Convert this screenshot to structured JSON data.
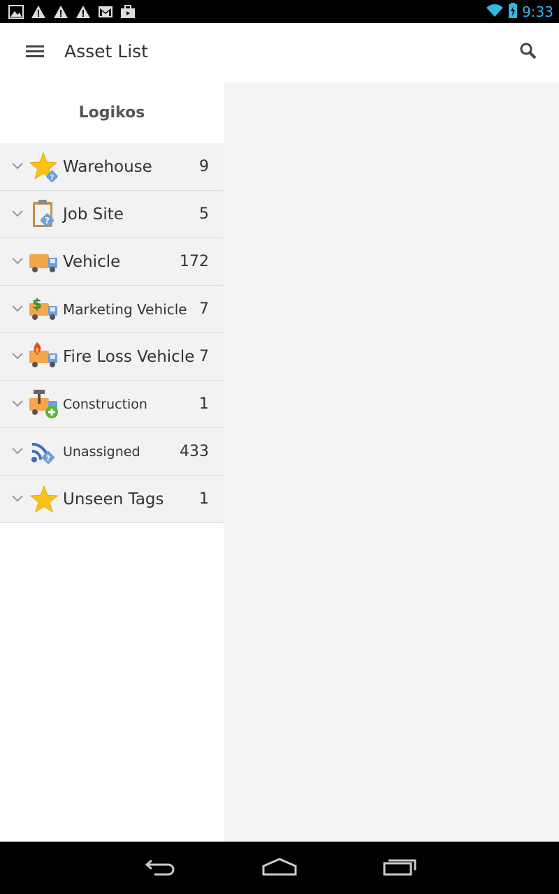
{
  "status_bar": {
    "time": "9:33",
    "left_icons": [
      "image-icon",
      "warning-icon",
      "warning-icon",
      "warning-icon",
      "gmail-icon",
      "briefcase-icon"
    ],
    "right_icons": [
      "wifi-icon",
      "battery-charging-icon"
    ],
    "time_color": "#33b5e5"
  },
  "app_bar": {
    "title": "Asset List",
    "menu_icon": "hamburger-menu-icon",
    "search_icon": "search-icon"
  },
  "sidebar": {
    "organization": "Logikos",
    "items": [
      {
        "label": "Warehouse",
        "count": "9",
        "icon": "star-question-icon"
      },
      {
        "label": "Job Site",
        "count": "5",
        "icon": "clipboard-question-icon"
      },
      {
        "label": "Vehicle",
        "count": "172",
        "icon": "truck-icon"
      },
      {
        "label": "Marketing Vehicle",
        "count": "7",
        "icon": "truck-dollar-icon"
      },
      {
        "label": "Fire Loss Vehicle",
        "count": "7",
        "icon": "truck-fire-icon"
      },
      {
        "label": "Construction",
        "count": "1",
        "icon": "truck-hammer-plus-icon"
      },
      {
        "label": "Unassigned",
        "count": "433",
        "icon": "signal-question-icon"
      },
      {
        "label": "Unseen Tags",
        "count": "1",
        "icon": "star-icon"
      }
    ]
  },
  "nav_bar": {
    "icons": [
      "back-icon",
      "home-icon",
      "recent-apps-icon"
    ]
  },
  "colors": {
    "list_background": "#f2f2f2",
    "content_background": "#f4f4f4",
    "accent_blue": "#33b5e5"
  }
}
